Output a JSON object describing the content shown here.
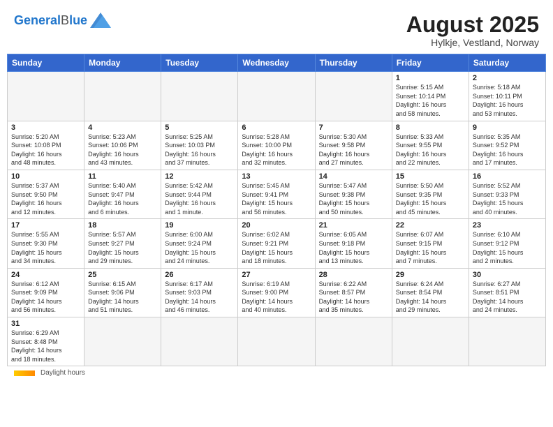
{
  "header": {
    "logo_general": "General",
    "logo_blue": "Blue",
    "month": "August 2025",
    "location": "Hylkje, Vestland, Norway"
  },
  "days_of_week": [
    "Sunday",
    "Monday",
    "Tuesday",
    "Wednesday",
    "Thursday",
    "Friday",
    "Saturday"
  ],
  "weeks": [
    [
      {
        "day": "",
        "info": ""
      },
      {
        "day": "",
        "info": ""
      },
      {
        "day": "",
        "info": ""
      },
      {
        "day": "",
        "info": ""
      },
      {
        "day": "",
        "info": ""
      },
      {
        "day": "1",
        "info": "Sunrise: 5:15 AM\nSunset: 10:14 PM\nDaylight: 16 hours\nand 58 minutes."
      },
      {
        "day": "2",
        "info": "Sunrise: 5:18 AM\nSunset: 10:11 PM\nDaylight: 16 hours\nand 53 minutes."
      }
    ],
    [
      {
        "day": "3",
        "info": "Sunrise: 5:20 AM\nSunset: 10:08 PM\nDaylight: 16 hours\nand 48 minutes."
      },
      {
        "day": "4",
        "info": "Sunrise: 5:23 AM\nSunset: 10:06 PM\nDaylight: 16 hours\nand 43 minutes."
      },
      {
        "day": "5",
        "info": "Sunrise: 5:25 AM\nSunset: 10:03 PM\nDaylight: 16 hours\nand 37 minutes."
      },
      {
        "day": "6",
        "info": "Sunrise: 5:28 AM\nSunset: 10:00 PM\nDaylight: 16 hours\nand 32 minutes."
      },
      {
        "day": "7",
        "info": "Sunrise: 5:30 AM\nSunset: 9:58 PM\nDaylight: 16 hours\nand 27 minutes."
      },
      {
        "day": "8",
        "info": "Sunrise: 5:33 AM\nSunset: 9:55 PM\nDaylight: 16 hours\nand 22 minutes."
      },
      {
        "day": "9",
        "info": "Sunrise: 5:35 AM\nSunset: 9:52 PM\nDaylight: 16 hours\nand 17 minutes."
      }
    ],
    [
      {
        "day": "10",
        "info": "Sunrise: 5:37 AM\nSunset: 9:50 PM\nDaylight: 16 hours\nand 12 minutes."
      },
      {
        "day": "11",
        "info": "Sunrise: 5:40 AM\nSunset: 9:47 PM\nDaylight: 16 hours\nand 6 minutes."
      },
      {
        "day": "12",
        "info": "Sunrise: 5:42 AM\nSunset: 9:44 PM\nDaylight: 16 hours\nand 1 minute."
      },
      {
        "day": "13",
        "info": "Sunrise: 5:45 AM\nSunset: 9:41 PM\nDaylight: 15 hours\nand 56 minutes."
      },
      {
        "day": "14",
        "info": "Sunrise: 5:47 AM\nSunset: 9:38 PM\nDaylight: 15 hours\nand 50 minutes."
      },
      {
        "day": "15",
        "info": "Sunrise: 5:50 AM\nSunset: 9:35 PM\nDaylight: 15 hours\nand 45 minutes."
      },
      {
        "day": "16",
        "info": "Sunrise: 5:52 AM\nSunset: 9:33 PM\nDaylight: 15 hours\nand 40 minutes."
      }
    ],
    [
      {
        "day": "17",
        "info": "Sunrise: 5:55 AM\nSunset: 9:30 PM\nDaylight: 15 hours\nand 34 minutes."
      },
      {
        "day": "18",
        "info": "Sunrise: 5:57 AM\nSunset: 9:27 PM\nDaylight: 15 hours\nand 29 minutes."
      },
      {
        "day": "19",
        "info": "Sunrise: 6:00 AM\nSunset: 9:24 PM\nDaylight: 15 hours\nand 24 minutes."
      },
      {
        "day": "20",
        "info": "Sunrise: 6:02 AM\nSunset: 9:21 PM\nDaylight: 15 hours\nand 18 minutes."
      },
      {
        "day": "21",
        "info": "Sunrise: 6:05 AM\nSunset: 9:18 PM\nDaylight: 15 hours\nand 13 minutes."
      },
      {
        "day": "22",
        "info": "Sunrise: 6:07 AM\nSunset: 9:15 PM\nDaylight: 15 hours\nand 7 minutes."
      },
      {
        "day": "23",
        "info": "Sunrise: 6:10 AM\nSunset: 9:12 PM\nDaylight: 15 hours\nand 2 minutes."
      }
    ],
    [
      {
        "day": "24",
        "info": "Sunrise: 6:12 AM\nSunset: 9:09 PM\nDaylight: 14 hours\nand 56 minutes."
      },
      {
        "day": "25",
        "info": "Sunrise: 6:15 AM\nSunset: 9:06 PM\nDaylight: 14 hours\nand 51 minutes."
      },
      {
        "day": "26",
        "info": "Sunrise: 6:17 AM\nSunset: 9:03 PM\nDaylight: 14 hours\nand 46 minutes."
      },
      {
        "day": "27",
        "info": "Sunrise: 6:19 AM\nSunset: 9:00 PM\nDaylight: 14 hours\nand 40 minutes."
      },
      {
        "day": "28",
        "info": "Sunrise: 6:22 AM\nSunset: 8:57 PM\nDaylight: 14 hours\nand 35 minutes."
      },
      {
        "day": "29",
        "info": "Sunrise: 6:24 AM\nSunset: 8:54 PM\nDaylight: 14 hours\nand 29 minutes."
      },
      {
        "day": "30",
        "info": "Sunrise: 6:27 AM\nSunset: 8:51 PM\nDaylight: 14 hours\nand 24 minutes."
      }
    ],
    [
      {
        "day": "31",
        "info": "Sunrise: 6:29 AM\nSunset: 8:48 PM\nDaylight: 14 hours\nand 18 minutes."
      },
      {
        "day": "",
        "info": ""
      },
      {
        "day": "",
        "info": ""
      },
      {
        "day": "",
        "info": ""
      },
      {
        "day": "",
        "info": ""
      },
      {
        "day": "",
        "info": ""
      },
      {
        "day": "",
        "info": ""
      }
    ]
  ],
  "footer": {
    "label": "Daylight hours"
  }
}
